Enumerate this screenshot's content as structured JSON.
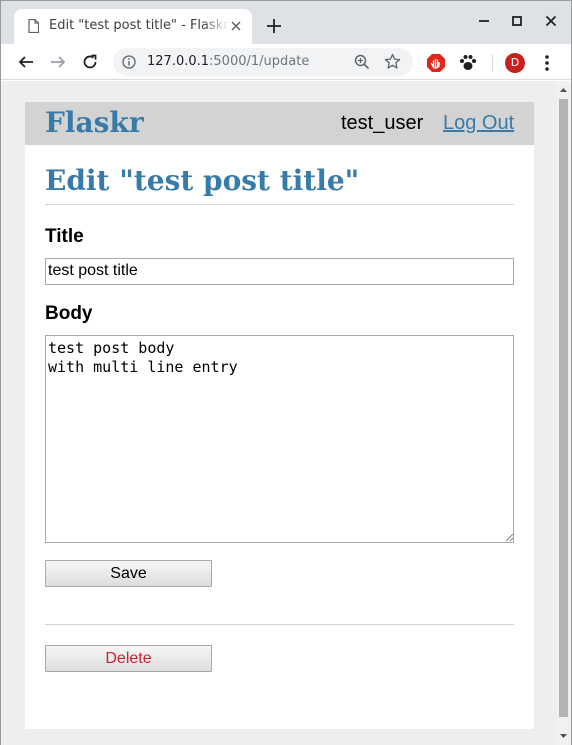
{
  "browser": {
    "tab_title": "Edit \"test post title\" - Flaskr",
    "url_host": "127.0.0.1",
    "url_rest": ":5000/1/update",
    "profile_initial": "D"
  },
  "nav": {
    "brand": "Flaskr",
    "username": "test_user",
    "logout_label": "Log Out"
  },
  "main": {
    "heading": "Edit \"test post title\"",
    "title_label": "Title",
    "title_value": "test post title",
    "body_label": "Body",
    "body_value": "test post body\nwith multi line entry",
    "save_label": "Save",
    "delete_label": "Delete"
  },
  "colors": {
    "link": "#377ba8",
    "danger": "#cc2233",
    "nav_bg": "#d3d3d3"
  }
}
